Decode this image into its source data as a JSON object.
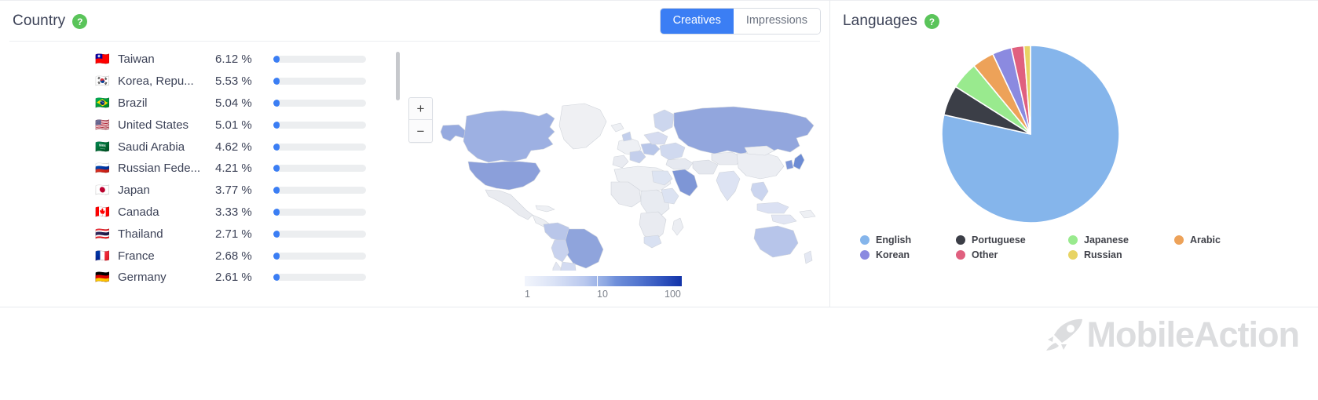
{
  "country_panel": {
    "title": "Country",
    "help_icon": "?",
    "toggle": {
      "options": [
        {
          "label": "Creatives",
          "active": true
        },
        {
          "label": "Impressions",
          "active": false
        }
      ]
    },
    "rows": [
      {
        "flag": "🇹🇼",
        "name": "Taiwan",
        "pct": "6.12 %",
        "value": 6.12
      },
      {
        "flag": "🇰🇷",
        "name": "Korea, Repu...",
        "pct": "5.53 %",
        "value": 5.53
      },
      {
        "flag": "🇧🇷",
        "name": "Brazil",
        "pct": "5.04 %",
        "value": 5.04
      },
      {
        "flag": "🇺🇸",
        "name": "United States",
        "pct": "5.01 %",
        "value": 5.01
      },
      {
        "flag": "🇸🇦",
        "name": "Saudi Arabia",
        "pct": "4.62 %",
        "value": 4.62
      },
      {
        "flag": "🇷🇺",
        "name": "Russian Fede...",
        "pct": "4.21 %",
        "value": 4.21
      },
      {
        "flag": "🇯🇵",
        "name": "Japan",
        "pct": "3.77 %",
        "value": 3.77
      },
      {
        "flag": "🇨🇦",
        "name": "Canada",
        "pct": "3.33 %",
        "value": 3.33
      },
      {
        "flag": "🇹🇭",
        "name": "Thailand",
        "pct": "2.71 %",
        "value": 2.71
      },
      {
        "flag": "🇫🇷",
        "name": "France",
        "pct": "2.68 %",
        "value": 2.68
      },
      {
        "flag": "🇩🇪",
        "name": "Germany",
        "pct": "2.61 %",
        "value": 2.61
      }
    ],
    "map": {
      "zoom_in_label": "+",
      "zoom_out_label": "−",
      "legend_ticks": [
        "1",
        "10",
        "100"
      ]
    }
  },
  "languages_panel": {
    "title": "Languages",
    "help_icon": "?"
  },
  "watermark": {
    "text": "MobileAction"
  },
  "chart_data": [
    {
      "type": "pie",
      "title": "Languages",
      "labels": [
        "English",
        "Portuguese",
        "Japanese",
        "Arabic",
        "Korean",
        "Other",
        "Russian"
      ],
      "values": [
        78.5,
        5.5,
        5.0,
        4.0,
        3.5,
        2.3,
        1.2
      ],
      "colors": [
        "#85b5eb",
        "#3b3e47",
        "#99ea8e",
        "#eda259",
        "#8b8ae0",
        "#e0607f",
        "#e8d464"
      ],
      "legend_position": "bottom",
      "legend_order": [
        "English",
        "Portuguese",
        "Japanese",
        "Arabic",
        "Korean",
        "Other",
        "Russian"
      ]
    },
    {
      "type": "bar",
      "title": "Country",
      "orientation": "horizontal",
      "categories": [
        "Taiwan",
        "Korea, Repu...",
        "Brazil",
        "United States",
        "Saudi Arabia",
        "Russian Fede...",
        "Japan",
        "Canada",
        "Thailand",
        "France",
        "Germany"
      ],
      "values": [
        6.12,
        5.53,
        5.04,
        5.01,
        4.62,
        4.21,
        3.77,
        3.33,
        2.71,
        2.68,
        2.61
      ],
      "xlabel": "",
      "ylabel": "",
      "xlim": [
        0,
        100
      ],
      "value_suffix": " %",
      "grid": false,
      "bar_color": "#3b7ef4",
      "track_color": "#eceef0"
    },
    {
      "type": "heatmap",
      "subtype": "choropleth-world-map",
      "title": "Country distribution",
      "colorbar": {
        "ticks": [
          1,
          10,
          100
        ],
        "scale": "log",
        "low_color": "#f2f5fc",
        "high_color": "#1233a8"
      },
      "highlighted": [
        "Taiwan",
        "Korea, Republic of",
        "Brazil",
        "United States",
        "Saudi Arabia",
        "Russian Federation",
        "Japan",
        "Canada",
        "Thailand",
        "France",
        "Germany"
      ]
    }
  ]
}
